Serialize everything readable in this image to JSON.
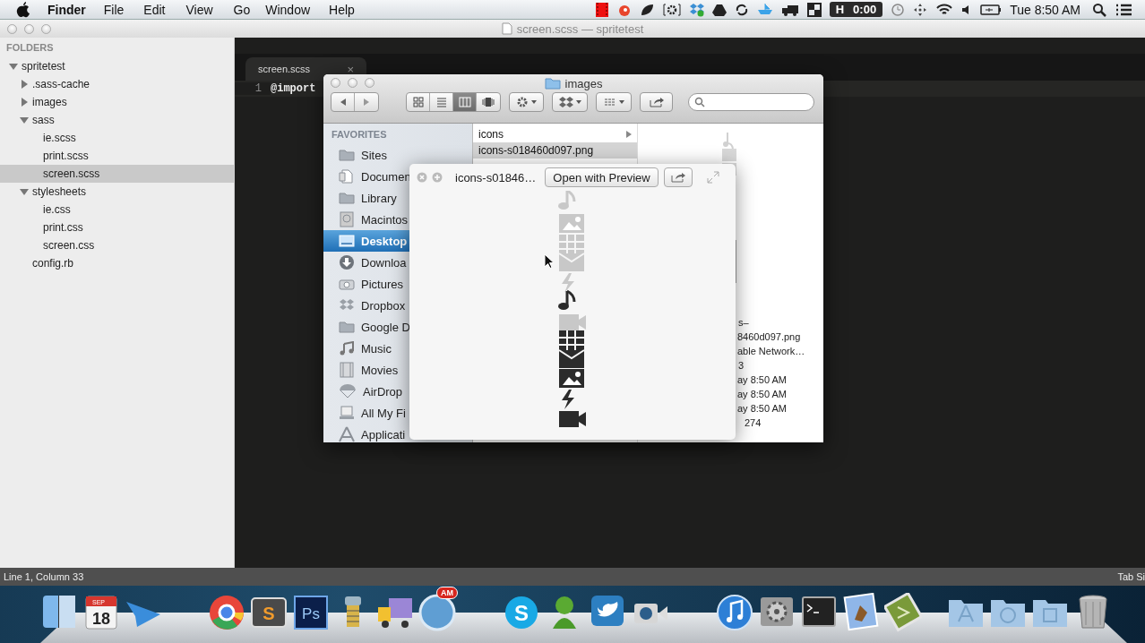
{
  "menu_bar": {
    "app": "Finder",
    "menus": [
      "File",
      "Edit",
      "View",
      "Go",
      "Window",
      "Help"
    ],
    "timer_letter": "H",
    "timer": "0:00",
    "clock": "Tue 8:50 AM"
  },
  "editor_window": {
    "title": "screen.scss — spritetest",
    "sidebar": {
      "heading": "FOLDERS",
      "tree": [
        {
          "label": "spritetest",
          "kind": "folder",
          "expanded": true,
          "selected": false,
          "children": [
            {
              "label": ".sass-cache",
              "kind": "folder",
              "expanded": false,
              "selected": false
            },
            {
              "label": "images",
              "kind": "folder",
              "expanded": false,
              "selected": false
            },
            {
              "label": "sass",
              "kind": "folder",
              "expanded": true,
              "selected": false,
              "children": [
                {
                  "label": "ie.scss",
                  "selected": false
                },
                {
                  "label": "print.scss",
                  "selected": false
                },
                {
                  "label": "screen.scss",
                  "selected": true
                }
              ]
            },
            {
              "label": "stylesheets",
              "kind": "folder",
              "expanded": true,
              "selected": false,
              "children": [
                {
                  "label": "ie.css",
                  "selected": false
                },
                {
                  "label": "print.css",
                  "selected": false
                },
                {
                  "label": "screen.css",
                  "selected": false
                }
              ]
            },
            {
              "label": "config.rb",
              "selected": false
            }
          ]
        }
      ]
    },
    "tabs": [
      {
        "label": "screen.scss",
        "close": "×",
        "selected": true
      }
    ],
    "lines": [
      {
        "number": "1",
        "code": "@import"
      }
    ],
    "status_bar": {
      "position": "Line 1, Column 33",
      "right": "Tab Si"
    }
  },
  "finder_window": {
    "title": "images",
    "view_modes": [
      {
        "kind": "icons",
        "selected": false
      },
      {
        "kind": "list",
        "selected": false
      },
      {
        "kind": "columns",
        "selected": true
      },
      {
        "kind": "coverflow",
        "selected": false
      }
    ],
    "sidebar": {
      "heading": "FAVORITES",
      "items": [
        {
          "label": "Sites",
          "kind": "folder",
          "selected": false
        },
        {
          "label": "Documen",
          "kind": "document",
          "selected": false
        },
        {
          "label": "Library",
          "kind": "folder",
          "selected": false
        },
        {
          "label": "Macintos",
          "kind": "drive",
          "selected": false
        },
        {
          "label": "Desktop",
          "kind": "desktop",
          "selected": true
        },
        {
          "label": "Downloa",
          "kind": "download",
          "selected": false
        },
        {
          "label": "Pictures",
          "kind": "camera",
          "selected": false
        },
        {
          "label": "Dropbox",
          "kind": "dropbox",
          "selected": false
        },
        {
          "label": "Google D",
          "kind": "folder",
          "selected": false
        },
        {
          "label": "Music",
          "kind": "music",
          "selected": false
        },
        {
          "label": "Movies",
          "kind": "movie",
          "selected": false
        },
        {
          "label": "AirDrop",
          "kind": "airdrop",
          "selected": false
        },
        {
          "label": "All My Fi",
          "kind": "files",
          "selected": false
        },
        {
          "label": "Applicati",
          "kind": "apps",
          "selected": false
        }
      ]
    },
    "column": [
      {
        "label": "icons",
        "kind": "folder",
        "selected": false
      },
      {
        "label": "icons-s018460d097.png",
        "kind": "file",
        "selected": true
      }
    ],
    "info": [
      "s–",
      "8460d097.png",
      "able Network…",
      "3",
      "ay 8:50 AM",
      "ay 8:50 AM",
      "ay 8:50 AM",
      "274"
    ]
  },
  "quick_look": {
    "title": "icons-s01846…",
    "open_button": "Open with Preview"
  },
  "dock": {
    "calendar_month": "SEP",
    "calendar_day": "18",
    "sublime_letter": "S",
    "photoshop": "Ps",
    "badge": "AM",
    "skype_letter": "S"
  }
}
